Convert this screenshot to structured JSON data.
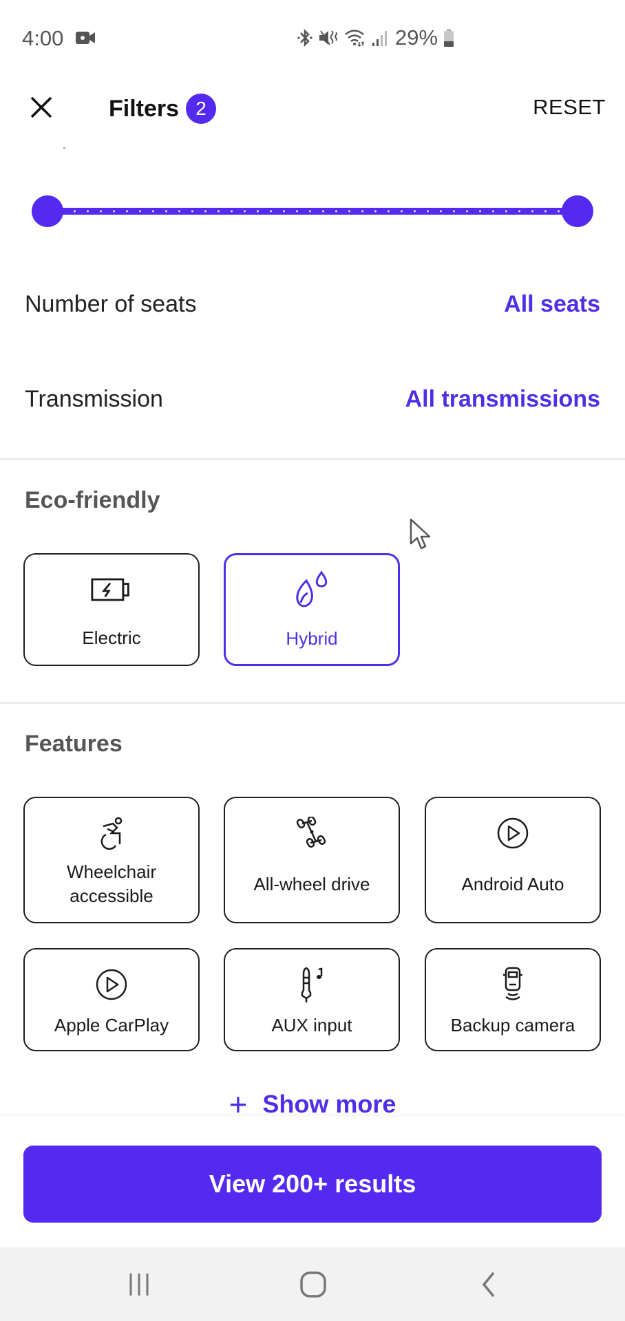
{
  "status_bar": {
    "time": "4:00",
    "battery_percent": "29%",
    "icons": [
      "video-record-icon",
      "bluetooth-icon",
      "mute-vibrate-icon",
      "wifi-icon",
      "signal-icon",
      "battery-icon"
    ]
  },
  "header": {
    "title": "Filters",
    "active_filter_count": "2",
    "reset_label": "RESET",
    "close_icon": "close-icon"
  },
  "price_slider": {
    "min_fraction": 0.0,
    "max_fraction": 1.0,
    "color": "#5429f0"
  },
  "rows": [
    {
      "label": "Number of seats",
      "value": "All seats"
    },
    {
      "label": "Transmission",
      "value": "All transmissions"
    }
  ],
  "eco": {
    "title": "Eco-friendly",
    "options": [
      {
        "label": "Electric",
        "icon": "battery-charging-icon",
        "selected": false
      },
      {
        "label": "Hybrid",
        "icon": "leaf-drop-icon",
        "selected": true
      }
    ]
  },
  "features": {
    "title": "Features",
    "options": [
      {
        "label": "Wheelchair accessible",
        "icon": "wheelchair-icon",
        "selected": false
      },
      {
        "label": "All-wheel drive",
        "icon": "drivetrain-icon",
        "selected": false
      },
      {
        "label": "Android Auto",
        "icon": "play-circle-icon",
        "selected": false
      },
      {
        "label": "Apple CarPlay",
        "icon": "play-circle-icon",
        "selected": false
      },
      {
        "label": "AUX input",
        "icon": "aux-jack-icon",
        "selected": false
      },
      {
        "label": "Backup camera",
        "icon": "backup-camera-icon",
        "selected": false
      }
    ],
    "show_more_label": "Show more"
  },
  "footer": {
    "results_button_label": "View 200+ results"
  },
  "colors": {
    "accent": "#5429f0",
    "accent_text": "#4f2ee6",
    "section_title": "#555555",
    "divider": "#ececec"
  }
}
